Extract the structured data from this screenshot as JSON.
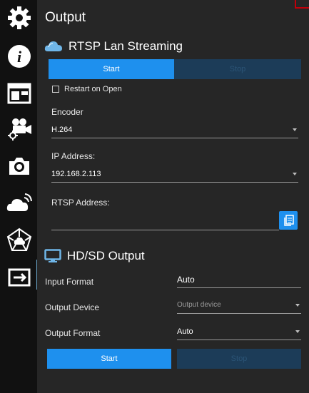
{
  "sidebar": {
    "items": [
      {
        "icon": "gear-icon"
      },
      {
        "icon": "info-icon"
      },
      {
        "icon": "layout-icon"
      },
      {
        "icon": "camera-settings-icon"
      },
      {
        "icon": "camera-icon"
      },
      {
        "icon": "cloud-stream-icon"
      },
      {
        "icon": "network-star-icon"
      },
      {
        "icon": "output-icon"
      }
    ]
  },
  "page": {
    "title": "Output"
  },
  "rtsp": {
    "header": "RTSP Lan Streaming",
    "start_label": "Start",
    "stop_label": "Stop",
    "restart_label": "Restart on Open",
    "encoder_label": "Encoder",
    "encoder_value": "H.264",
    "ip_label": "IP Address:",
    "ip_value": "192.168.2.113",
    "rtsp_address_label": "RTSP Address:",
    "rtsp_address_value": ""
  },
  "hdsd": {
    "header": "HD/SD Output",
    "input_format_label": "Input Format",
    "input_format_value": "Auto",
    "output_device_label": "Output Device",
    "output_device_placeholder": "Output device",
    "output_format_label": "Output Format",
    "output_format_value": "Auto",
    "start_label": "Start",
    "stop_label": "Stop"
  },
  "colors": {
    "accent": "#1e90ee",
    "disabled": "#1c3c58",
    "sidebar": "#111111",
    "background": "#262626"
  }
}
